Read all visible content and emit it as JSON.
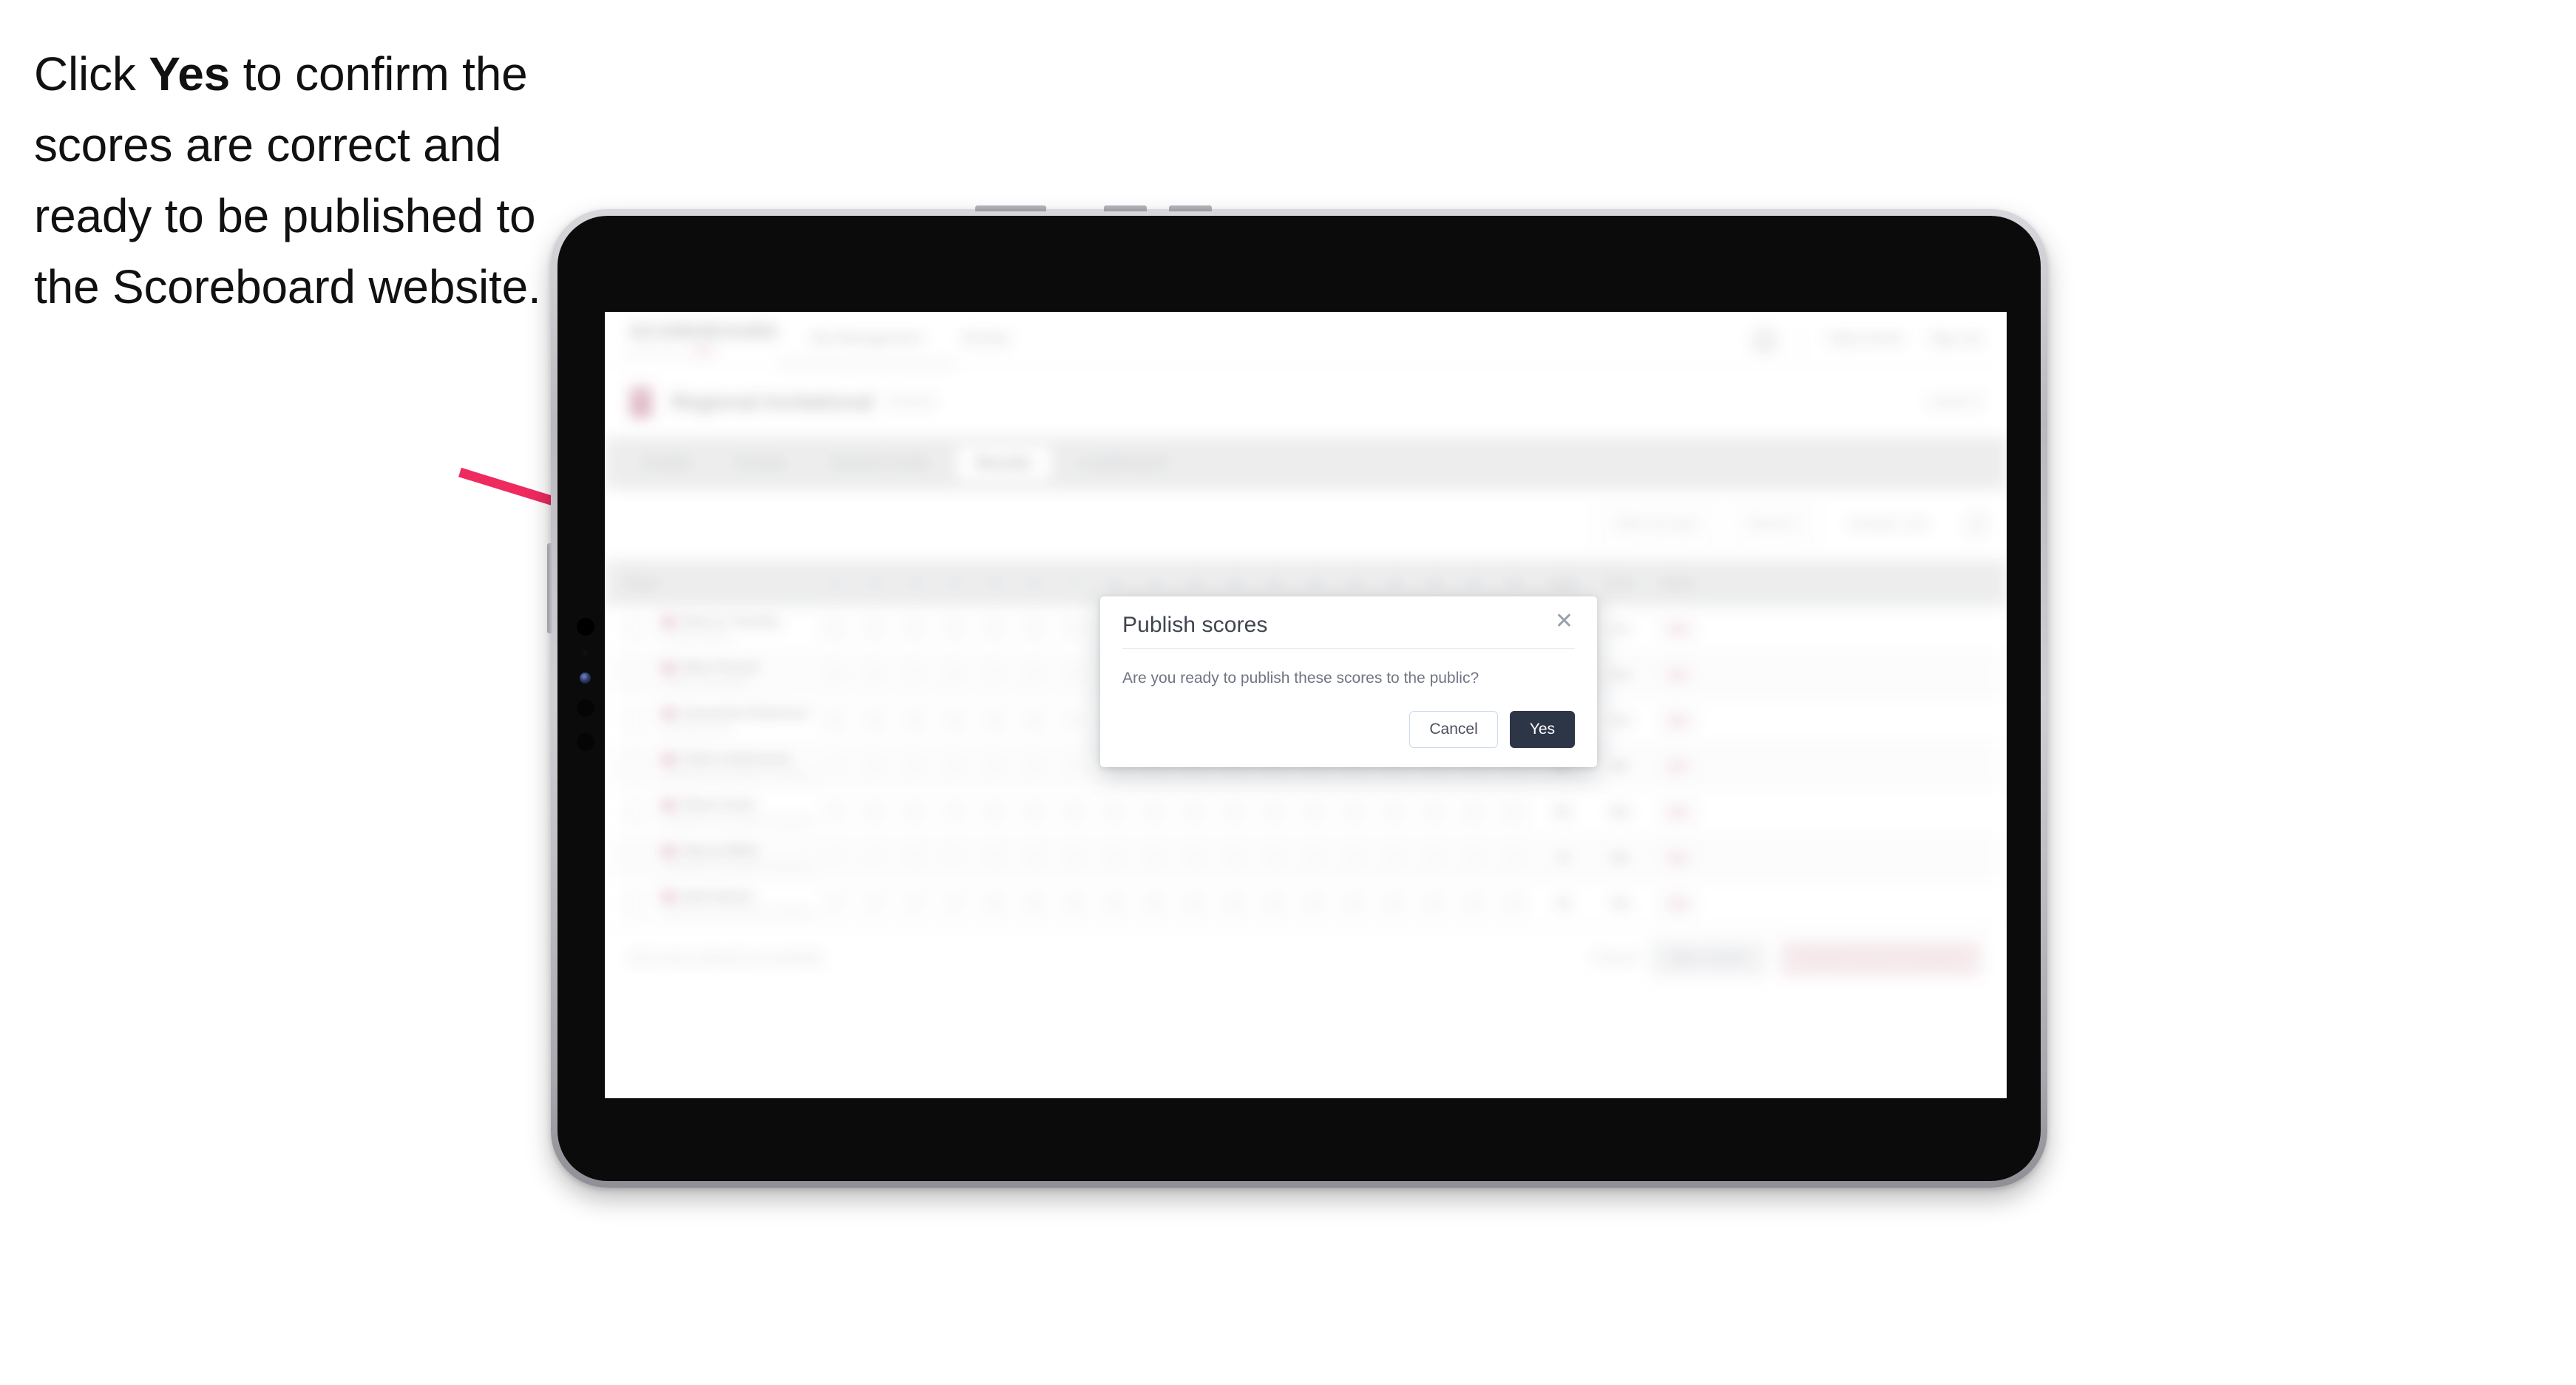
{
  "instruction": {
    "before": "Click ",
    "emphasis": "Yes",
    "after": " to confirm the scores are correct and ready to be published to the Scoreboard website."
  },
  "annotation": {
    "arrow_color": "#ee2a5f"
  },
  "device": {
    "type": "tablet",
    "frame_color": "#b9b9bf",
    "bezel_color": "#0b0b0c"
  },
  "app": {
    "topbar": {
      "brand": "SCOREBOARD",
      "brand_sub": "powered by",
      "nav": [
        "My Management",
        "Events"
      ],
      "right_links": [
        "Help Centre",
        "Sign out"
      ],
      "bell_icon": "bell-icon"
    },
    "title_row": {
      "event_title": "Regional Invitational",
      "event_sub": "Event",
      "right_meta": "Level 3"
    },
    "tabs": [
      {
        "label": "Details",
        "active": false
      },
      {
        "label": "Entries",
        "active": false
      },
      {
        "label": "Session Order",
        "active": false
      },
      {
        "label": "Results",
        "active": true
      },
      {
        "label": "Leaderboard",
        "active": false
      }
    ],
    "filters": [
      {
        "label": "Filter by team",
        "type": "select"
      },
      {
        "label": "Round 1",
        "type": "select"
      },
      {
        "label": "Session one",
        "type": "select"
      }
    ],
    "filter_icon": "filter-icon",
    "table": {
      "columns": [
        "Player",
        "1",
        "2",
        "3",
        "4",
        "5",
        "6",
        "7",
        "8",
        "9",
        "10",
        "11",
        "12",
        "13",
        "14",
        "15",
        "16",
        "17",
        "18",
        "Total",
        "Place",
        "Status"
      ],
      "rows": [
        {
          "name": "Marcus Townley",
          "club": "Eastern Athletic",
          "scores": [
            "8",
            "9",
            "8",
            "9",
            "8",
            "9",
            "8",
            "9",
            "8",
            "9",
            "8",
            "9",
            "8",
            "9",
            "8",
            "9",
            "8",
            "9"
          ],
          "total": "88",
          "place": "1st",
          "status": "OK"
        },
        {
          "name": "Ellen Parnell",
          "club": "Central Gymnastics",
          "scores": [
            "8",
            "8",
            "9",
            "8",
            "9",
            "8",
            "9",
            "8",
            "9",
            "8",
            "9",
            "8",
            "9",
            "8",
            "9",
            "8",
            "9",
            "8"
          ],
          "total": "86",
          "place": "2nd",
          "status": "OK"
        },
        {
          "name": "Samantha Robertson",
          "club": "Northside Club",
          "scores": [
            "8",
            "8",
            "8",
            "9",
            "8",
            "8",
            "9",
            "8",
            "8",
            "9",
            "8",
            "8",
            "9",
            "8",
            "8",
            "9",
            "8",
            "8"
          ],
          "total": "84",
          "place": "3rd",
          "status": "OK"
        },
        {
          "name": "Chloe Underwood",
          "club": "Southbank Gymnastics Academy",
          "scores": [
            "7",
            "8",
            "8",
            "8",
            "8",
            "8",
            "9",
            "8",
            "8",
            "8",
            "8",
            "8",
            "8",
            "8",
            "8",
            "8",
            "8",
            "8"
          ],
          "total": "82",
          "place": "4th",
          "status": "OK"
        },
        {
          "name": "Rhian Grant",
          "club": "Southbank Gymnastics Academy",
          "scores": [
            "7",
            "8",
            "8",
            "7",
            "8",
            "8",
            "8",
            "8",
            "8",
            "8",
            "8",
            "8",
            "8",
            "8",
            "8",
            "8",
            "8",
            "8"
          ],
          "total": "80",
          "place": "5th",
          "status": "OK"
        },
        {
          "name": "Nancy Webb",
          "club": "Southbank Gymnastics Academy",
          "scores": [
            "7",
            "7",
            "8",
            "7",
            "8",
            "8",
            "8",
            "8",
            "8",
            "8",
            "8",
            "8",
            "8",
            "8",
            "8",
            "8",
            "8",
            "8"
          ],
          "total": "78",
          "place": "6th",
          "status": "OK"
        },
        {
          "name": "Beth Barker",
          "club": "Southbank Gymnastics Academy",
          "scores": [
            "7",
            "7",
            "7",
            "7",
            "8",
            "8",
            "8",
            "8",
            "8",
            "8",
            "8",
            "8",
            "8",
            "8",
            "8",
            "8",
            "8",
            "8"
          ],
          "total": "76",
          "place": "7th",
          "status": "OK"
        }
      ]
    },
    "bottom_bar": {
      "note": "All scores entered successfully",
      "link": "Cancel",
      "save_label": "Save scores",
      "publish_label": "Publish scores to website"
    }
  },
  "modal": {
    "title": "Publish scores",
    "close_icon": "close-icon",
    "body": "Are you ready to publish these scores to the public?",
    "cancel_label": "Cancel",
    "confirm_label": "Yes",
    "confirm_bg": "#2c3647"
  }
}
